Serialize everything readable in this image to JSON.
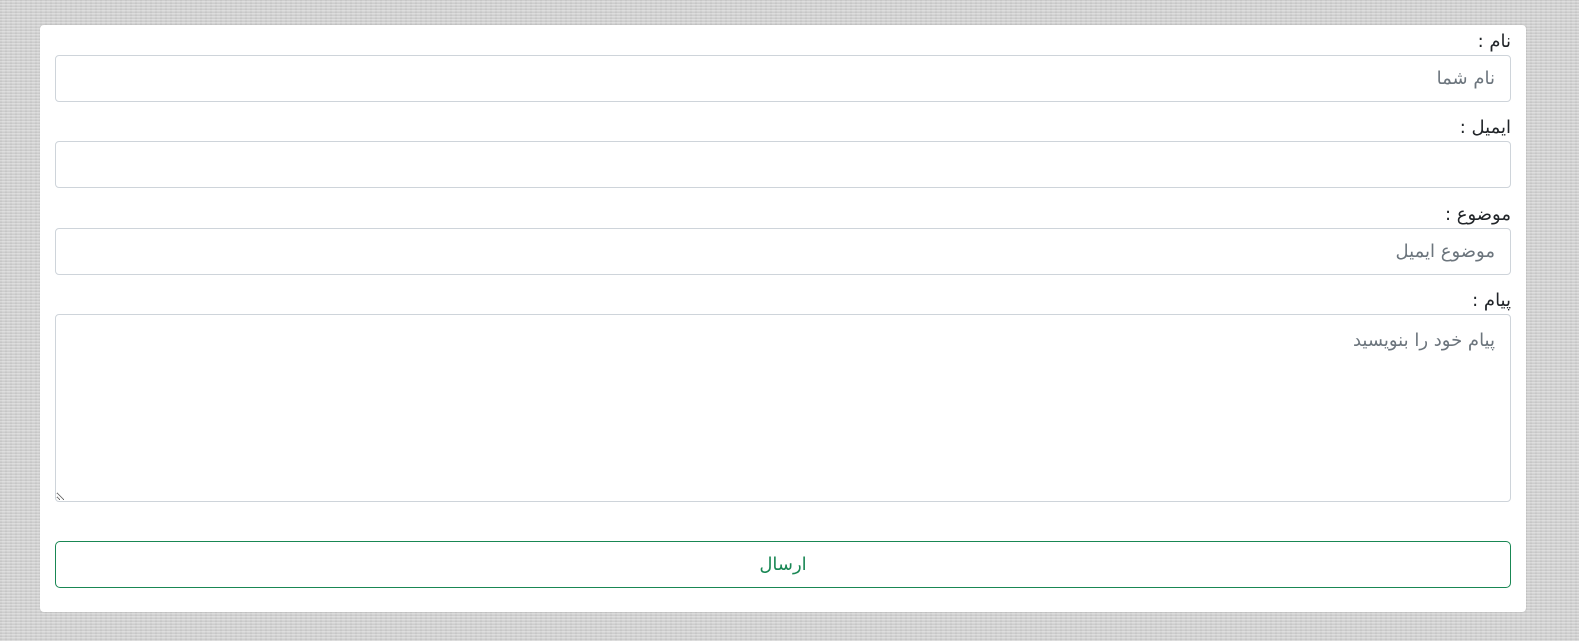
{
  "form": {
    "name": {
      "label": "نام :",
      "placeholder": "نام شما",
      "value": ""
    },
    "email": {
      "label": "ایمیل :",
      "placeholder": "",
      "value": ""
    },
    "subject": {
      "label": "موضوع :",
      "placeholder": "موضوع ایمیل",
      "value": ""
    },
    "message": {
      "label": "پیام :",
      "placeholder": "پیام خود را بنویسید",
      "value": ""
    },
    "submit_label": "ارسال"
  },
  "colors": {
    "accent": "#198754",
    "border": "#ced4da",
    "placeholder": "#6c757d",
    "label": "#212529",
    "page_background": "#d3d3d3"
  }
}
